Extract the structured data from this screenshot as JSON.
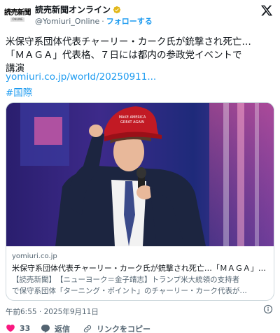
{
  "account": {
    "logo_text": "読売新聞",
    "logo_sub": "ONLINE",
    "display_name": "読売新聞オンライン",
    "handle": "@Yomiuri_Online",
    "separator": "·",
    "follow_label": "フォローする"
  },
  "tweet": {
    "text_lines": [
      "米保守系団体代表チャーリー・カーク氏が銃撃され死亡…",
      "「ＭＡＧＡ」代表格、７日には都内の参政党イベントで",
      "講演"
    ],
    "link": "yomiuri.co.jp/world/20250911...",
    "hashtag": "#国際"
  },
  "card": {
    "domain": "yomiuri.co.jp",
    "title": "米保守系団体代表チャーリー・カーク氏が銃撃され死亡…「ＭＡＧＡ」…",
    "desc_lines": [
      "【読売新聞】　【ニューヨーク＝金子靖志】トランプ米大統領の支持者",
      "で保守系団体「ターニング・ポイント」のチャーリー・カーク代表が…"
    ],
    "hat_text": "MAKE AMERICA GREAT AGAIN"
  },
  "meta": {
    "timestamp": "午前6:55 · 2025年9月11日"
  },
  "actions": {
    "like_count": "33",
    "reply_label": "返信",
    "copy_link_label": "リンクをコピー"
  },
  "colors": {
    "accent": "#1d9bf0",
    "like": "#f91880",
    "verified": "#e2b719",
    "text": "#0f1419",
    "muted": "#536471"
  }
}
